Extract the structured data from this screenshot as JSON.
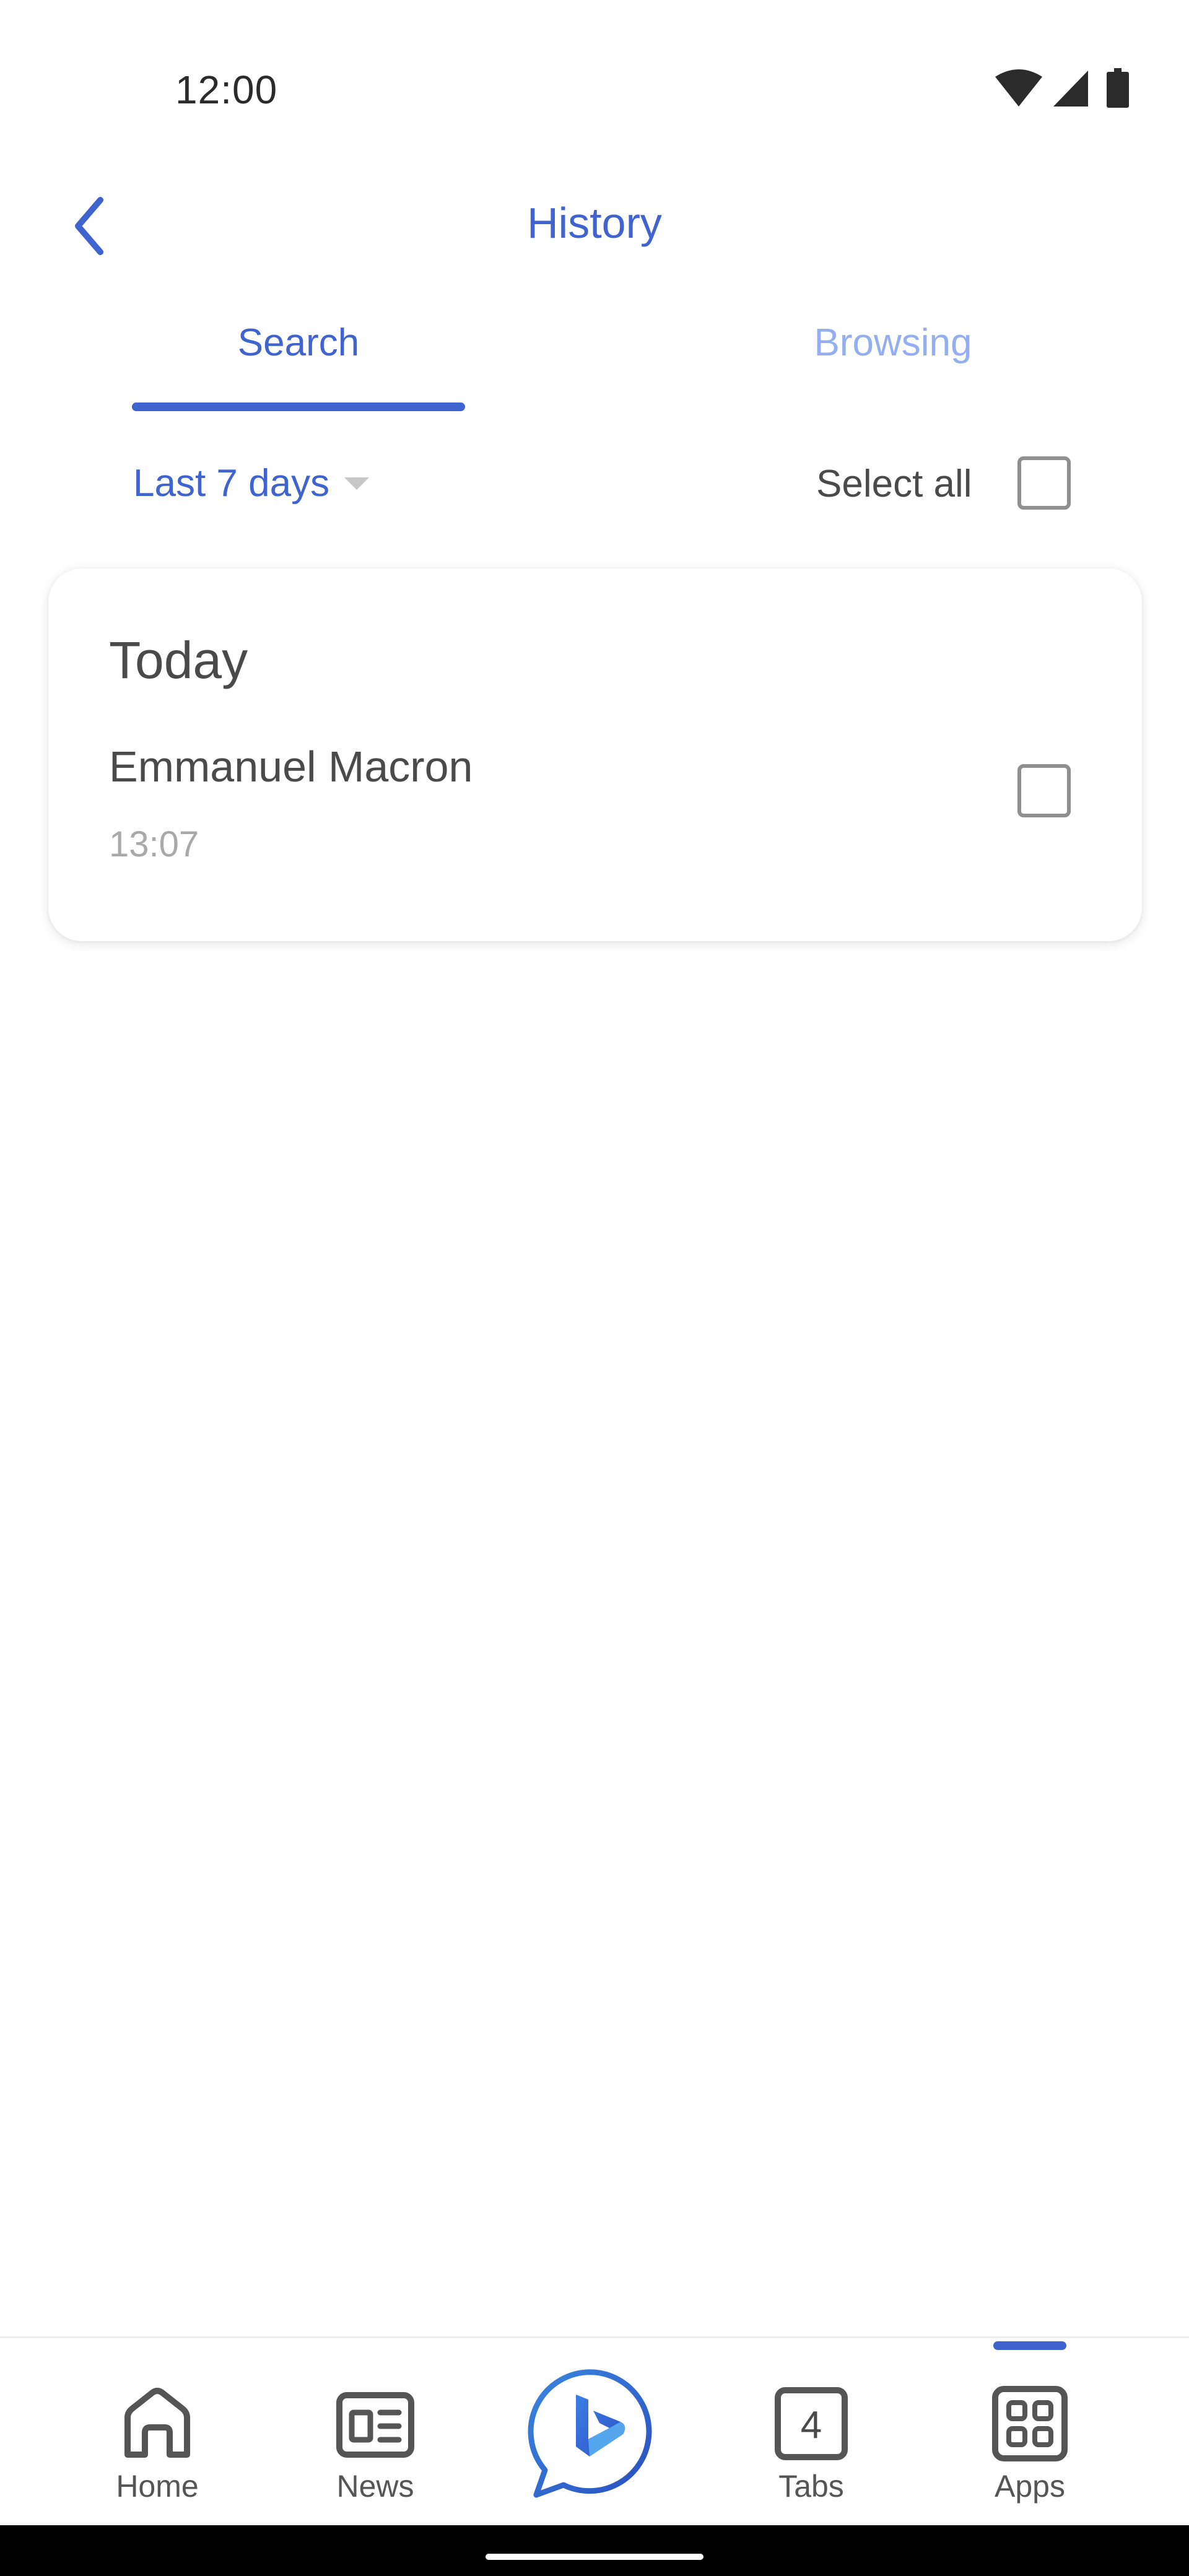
{
  "status_bar": {
    "time": "12:00",
    "icons": [
      "wifi-icon",
      "signal-icon",
      "battery-icon"
    ]
  },
  "header": {
    "title": "History",
    "back_icon": "chevron-left-icon"
  },
  "tabs": [
    {
      "label": "Search",
      "active": true
    },
    {
      "label": "Browsing",
      "active": false
    }
  ],
  "filter": {
    "range_label": "Last 7 days",
    "caret_icon": "caret-down-icon",
    "select_all_label": "Select all",
    "select_all_checked": false
  },
  "history": {
    "groups": [
      {
        "title": "Today",
        "items": [
          {
            "query": "Emmanuel Macron",
            "time": "13:07",
            "checked": false
          }
        ]
      }
    ]
  },
  "bottom_nav": {
    "items": [
      {
        "label": "Home",
        "icon": "home-icon"
      },
      {
        "label": "News",
        "icon": "news-icon"
      },
      {
        "label": "",
        "icon": "bing-chat-icon"
      },
      {
        "label": "Tabs",
        "icon": "tabs-icon",
        "count": "4"
      },
      {
        "label": "Apps",
        "icon": "apps-grid-icon",
        "active": true
      }
    ]
  },
  "colors": {
    "accent": "#3f63cf",
    "accent_light": "#94aef0",
    "text": "#4a4a4a",
    "muted": "#a9a9a9"
  }
}
